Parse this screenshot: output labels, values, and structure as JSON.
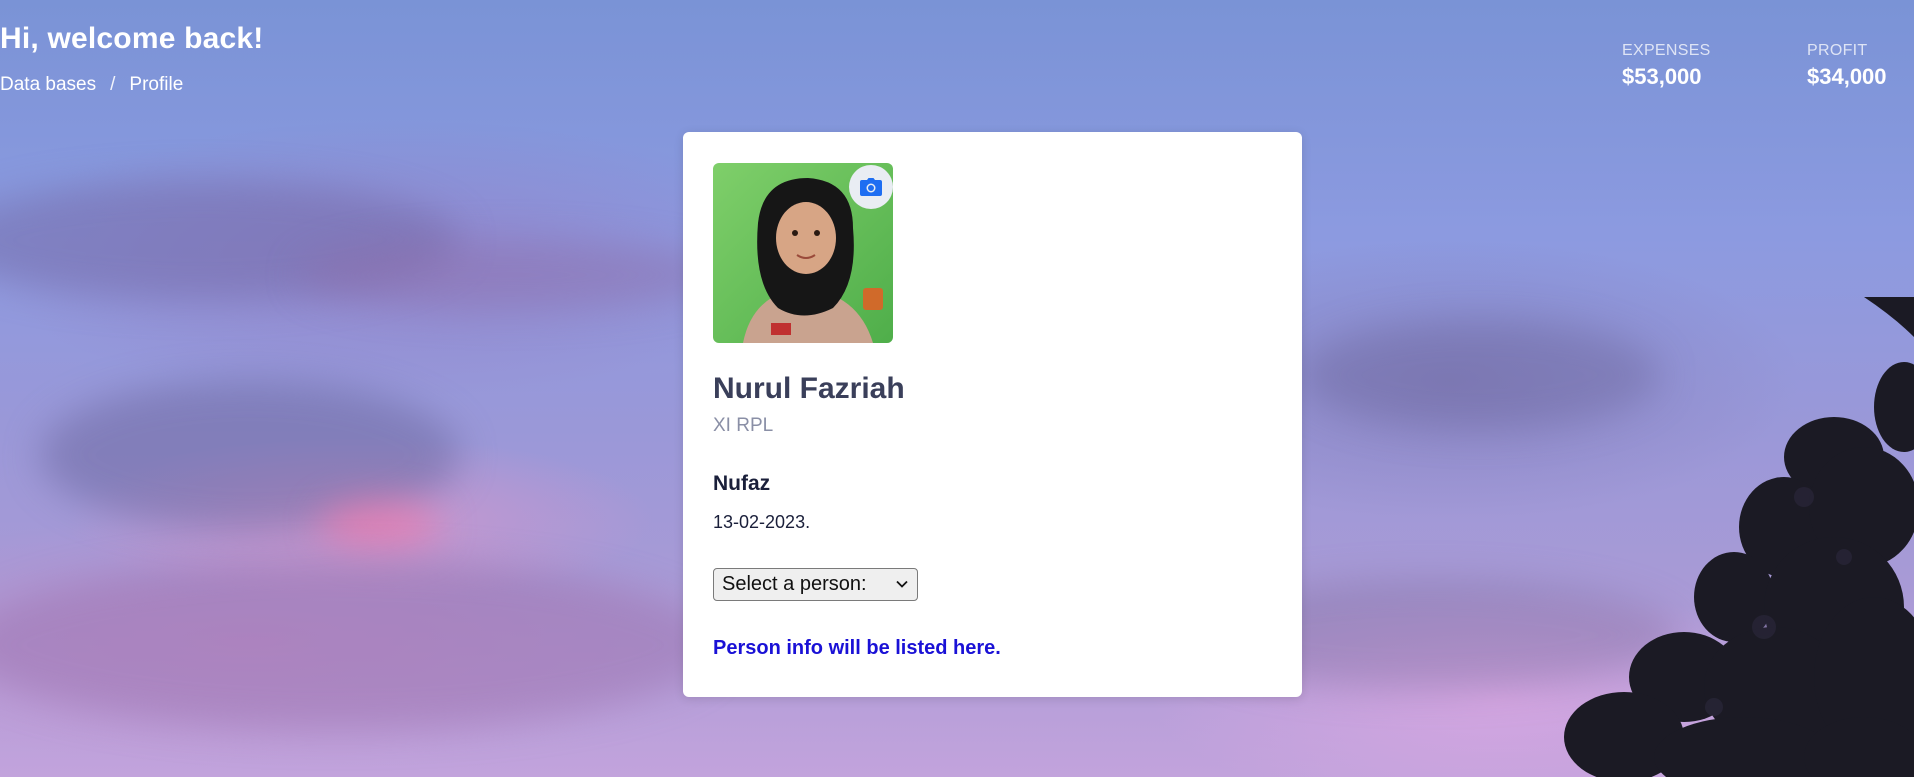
{
  "header": {
    "greeting": "Hi, welcome back!",
    "breadcrumb": [
      "Data bases",
      "Profile"
    ],
    "separator": "/"
  },
  "stats": [
    {
      "label": "EXPENSES",
      "value": "$53,000"
    },
    {
      "label": "PROFIT",
      "value": "$34,000"
    }
  ],
  "profile": {
    "name": "Nurul Fazriah",
    "class": "XI RPL",
    "nickname": "Nufaz",
    "date": "13-02-2023.",
    "select_placeholder": "Select a person:",
    "info_text": "Person info will be listed here.",
    "camera_icon": "camera-icon",
    "accent_color": "#1a11d6",
    "camera_color": "#1e6ef2"
  }
}
